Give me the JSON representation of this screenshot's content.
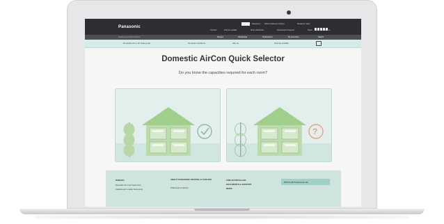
{
  "site": {
    "logo": "Panasonic",
    "top_links": [
      "Newsroom",
      "About Heating & Cooling",
      "Panasonic sites"
    ],
    "util_links": [
      "ProClub",
      "Find an installer",
      "Find a distributor",
      "Downloads & Support",
      "News",
      "Contact us"
    ],
    "sub_left": "Heating & cooling solutions",
    "menu": [
      "Ranges",
      "Residential",
      "Professional",
      "My favourites",
      "Search"
    ],
    "tabs": [
      "Domestic air to air heat pump",
      "Compare solutions",
      "Ask us",
      "Find an installer"
    ]
  },
  "main": {
    "title": "Domestic AirCon Quick Selector",
    "subtitle": "Do you know the capacities required for each room?"
  },
  "cards": [
    {
      "badge_icon": "check-icon",
      "badge_color": "#8fb8a8"
    },
    {
      "badge_icon": "question-icon",
      "badge_color": "#e8a188",
      "badge_text": "?"
    }
  ],
  "footer": {
    "col1_heading": "RANGES",
    "col1_links": [
      "Domestic air to air heat pump",
      "Aquarea air to water heat pump"
    ],
    "col2_heading": "ABOUT PANASONIC HEATING & COOLING",
    "col2_links": [
      "Philosophy & History"
    ],
    "col3_heading": "FIND AN INSTALLER",
    "col3_links": [
      "DOCUMENTS & SUPPORT",
      "NEWS"
    ],
    "proclub": "PROCLUB Professional site"
  },
  "colors": {
    "accent": "#d7ebe8",
    "header": "#2c2e31",
    "footer": "#cfe4de"
  }
}
